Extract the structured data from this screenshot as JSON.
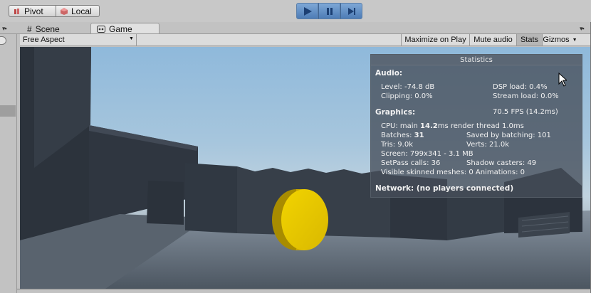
{
  "toolbar": {
    "pivot_label": "Pivot",
    "local_label": "Local"
  },
  "tabs": [
    {
      "label": "Scene"
    },
    {
      "label": "Game"
    }
  ],
  "game_bar": {
    "aspect_value": "Free Aspect",
    "maximize_label": "Maximize on Play",
    "mute_label": "Mute audio",
    "stats_label": "Stats",
    "gizmos_label": "Gizmos"
  },
  "statistics": {
    "title": "Statistics",
    "audio_heading": "Audio:",
    "level": "Level: -74.8 dB",
    "dsp_load": "DSP load: 0.4%",
    "clipping": "Clipping: 0.0%",
    "stream_load": "Stream load: 0.0%",
    "graphics_heading": "Graphics:",
    "fps": "70.5 FPS (14.2ms)",
    "cpu_prefix": "CPU: main ",
    "cpu_main": "14.2",
    "cpu_suffix": "ms  render thread 1.0ms",
    "batches_prefix": "Batches: ",
    "batches_value": "31",
    "saved_batching": "Saved by batching: 101",
    "tris": "Tris: 9.0k",
    "verts": "Verts: 21.0k",
    "screen": "Screen: 799x341 - 3.1 MB",
    "setpass": "SetPass calls: 36",
    "shadow_casters": "Shadow casters: 49",
    "skinned_animations": "Visible skinned meshes: 0  Animations: 0",
    "network": "Network: (no players connected)"
  },
  "colors": {
    "play_accent": "#5a88c2",
    "coin": "#e2c200",
    "stats_bg": "#464e5a"
  },
  "icons": [
    "pivot-icon",
    "local-icon",
    "play-icon",
    "pause-icon",
    "step-icon",
    "scene-grid-icon",
    "game-icon",
    "dropdown-arrow-icon",
    "menu-dots-icon",
    "mouse-cursor-icon"
  ]
}
